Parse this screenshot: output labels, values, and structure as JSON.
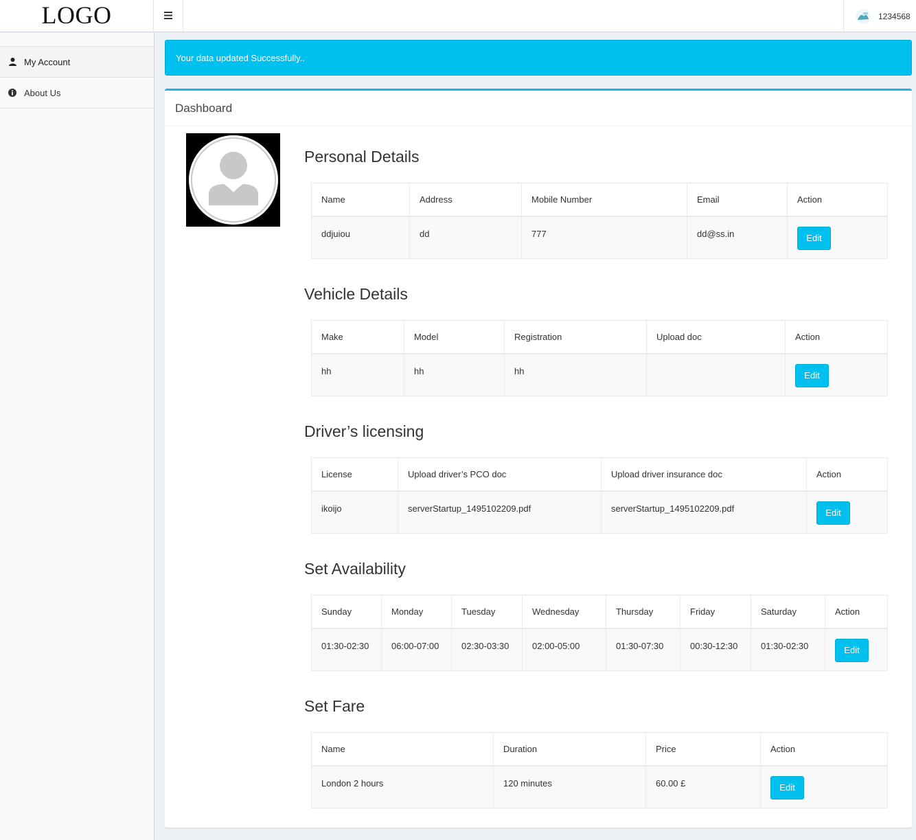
{
  "header": {
    "logo": "LOGO",
    "menu_toggle_icon": "hamburger-icon",
    "user_name": "1234568"
  },
  "sidebar": {
    "items": [
      {
        "label": "My Account",
        "icon": "user-icon"
      },
      {
        "label": "About Us",
        "icon": "info-circle-icon"
      }
    ]
  },
  "alert": {
    "message": "Your data updated Successfully.."
  },
  "colors": {
    "accent": "#00c0ef",
    "alert_bg": "#00c0ef",
    "box_top": "#1ab4e6"
  },
  "dashboard": {
    "title": "Dashboard",
    "personal": {
      "title": "Personal Details",
      "headers": [
        "Name",
        "Address",
        "Mobile Number",
        "Email",
        "Action"
      ],
      "row": [
        "ddjuiou",
        "dd",
        "777",
        "dd@ss.in"
      ],
      "action_label": "Edit"
    },
    "vehicle": {
      "title": "Vehicle Details",
      "headers": [
        "Make",
        "Model",
        "Registration",
        "Upload doc",
        "Action"
      ],
      "row": [
        "hh",
        "hh",
        "hh",
        ""
      ],
      "action_label": "Edit"
    },
    "licensing": {
      "title": "Driver’s licensing",
      "headers": [
        "License",
        "Upload driver’s PCO doc",
        "Upload driver insurance doc",
        "Action"
      ],
      "row": [
        "ikoijo",
        "serverStartup_1495102209.pdf",
        "serverStartup_1495102209.pdf"
      ],
      "action_label": "Edit"
    },
    "availability": {
      "title": "Set Availability",
      "headers": [
        "Sunday",
        "Monday",
        "Tuesday",
        "Wednesday",
        "Thursday",
        "Friday",
        "Saturday",
        "Action"
      ],
      "row": [
        "01:30-02:30",
        "06:00-07:00",
        "02:30-03:30",
        "02:00-05:00",
        "01:30-07:30",
        "00:30-12:30",
        "01:30-02:30"
      ],
      "action_label": "Edit"
    },
    "fare": {
      "title": "Set Fare",
      "headers": [
        "Name",
        "Duration",
        "Price",
        "Action"
      ],
      "row": [
        "London 2 hours",
        "120 minutes",
        "60.00 £"
      ],
      "action_label": "Edit"
    }
  }
}
